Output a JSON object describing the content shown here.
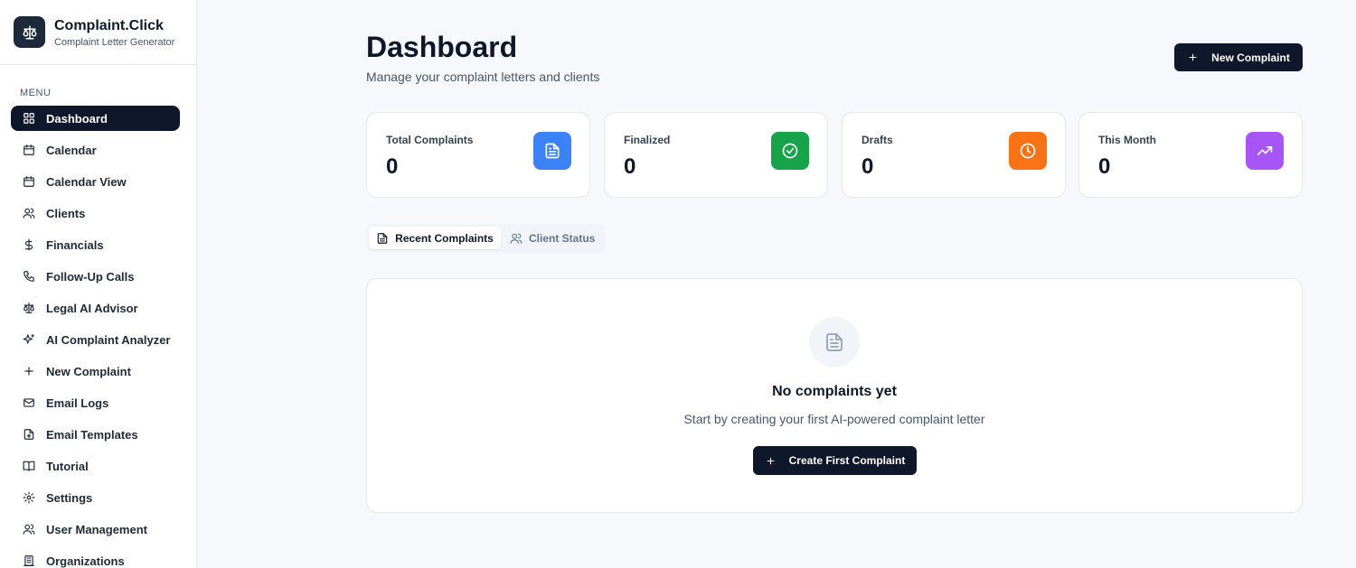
{
  "brand": {
    "title": "Complaint.Click",
    "subtitle": "Complaint Letter Generator",
    "logo_icon": "scale-icon"
  },
  "sidebar": {
    "menu_label": "MENU",
    "items": [
      {
        "label": "Dashboard",
        "icon": "dashboard-grid-icon",
        "active": true
      },
      {
        "label": "Calendar",
        "icon": "calendar-icon"
      },
      {
        "label": "Calendar View",
        "icon": "calendar-icon"
      },
      {
        "label": "Clients",
        "icon": "users-icon"
      },
      {
        "label": "Financials",
        "icon": "dollar-icon"
      },
      {
        "label": "Follow-Up Calls",
        "icon": "phone-icon"
      },
      {
        "label": "Legal AI Advisor",
        "icon": "scale-icon"
      },
      {
        "label": "AI Complaint Analyzer",
        "icon": "sparkles-icon"
      },
      {
        "label": "New Complaint",
        "icon": "plus-icon"
      },
      {
        "label": "Email Logs",
        "icon": "mail-icon"
      },
      {
        "label": "Email Templates",
        "icon": "file-template-icon"
      },
      {
        "label": "Tutorial",
        "icon": "book-icon"
      },
      {
        "label": "Settings",
        "icon": "gear-icon"
      },
      {
        "label": "User Management",
        "icon": "users-icon"
      },
      {
        "label": "Organizations",
        "icon": "building-icon"
      }
    ]
  },
  "header": {
    "title": "Dashboard",
    "subtitle": "Manage your complaint letters and clients",
    "new_button_label": "New Complaint"
  },
  "stats": [
    {
      "label": "Total Complaints",
      "value": "0",
      "color": "#3b82f6",
      "icon": "document-icon"
    },
    {
      "label": "Finalized",
      "value": "0",
      "color": "#16a34a",
      "icon": "check-circle-icon"
    },
    {
      "label": "Drafts",
      "value": "0",
      "color": "#f97316",
      "icon": "clock-icon"
    },
    {
      "label": "This Month",
      "value": "0",
      "color": "#a855f7",
      "icon": "trending-up-icon"
    }
  ],
  "tabs": [
    {
      "label": "Recent Complaints",
      "icon": "document-icon",
      "active": true
    },
    {
      "label": "Client Status",
      "icon": "users-icon",
      "active": false
    }
  ],
  "empty_state": {
    "title": "No complaints yet",
    "subtitle": "Start by creating your first AI-powered complaint letter",
    "button_label": "Create First Complaint"
  }
}
